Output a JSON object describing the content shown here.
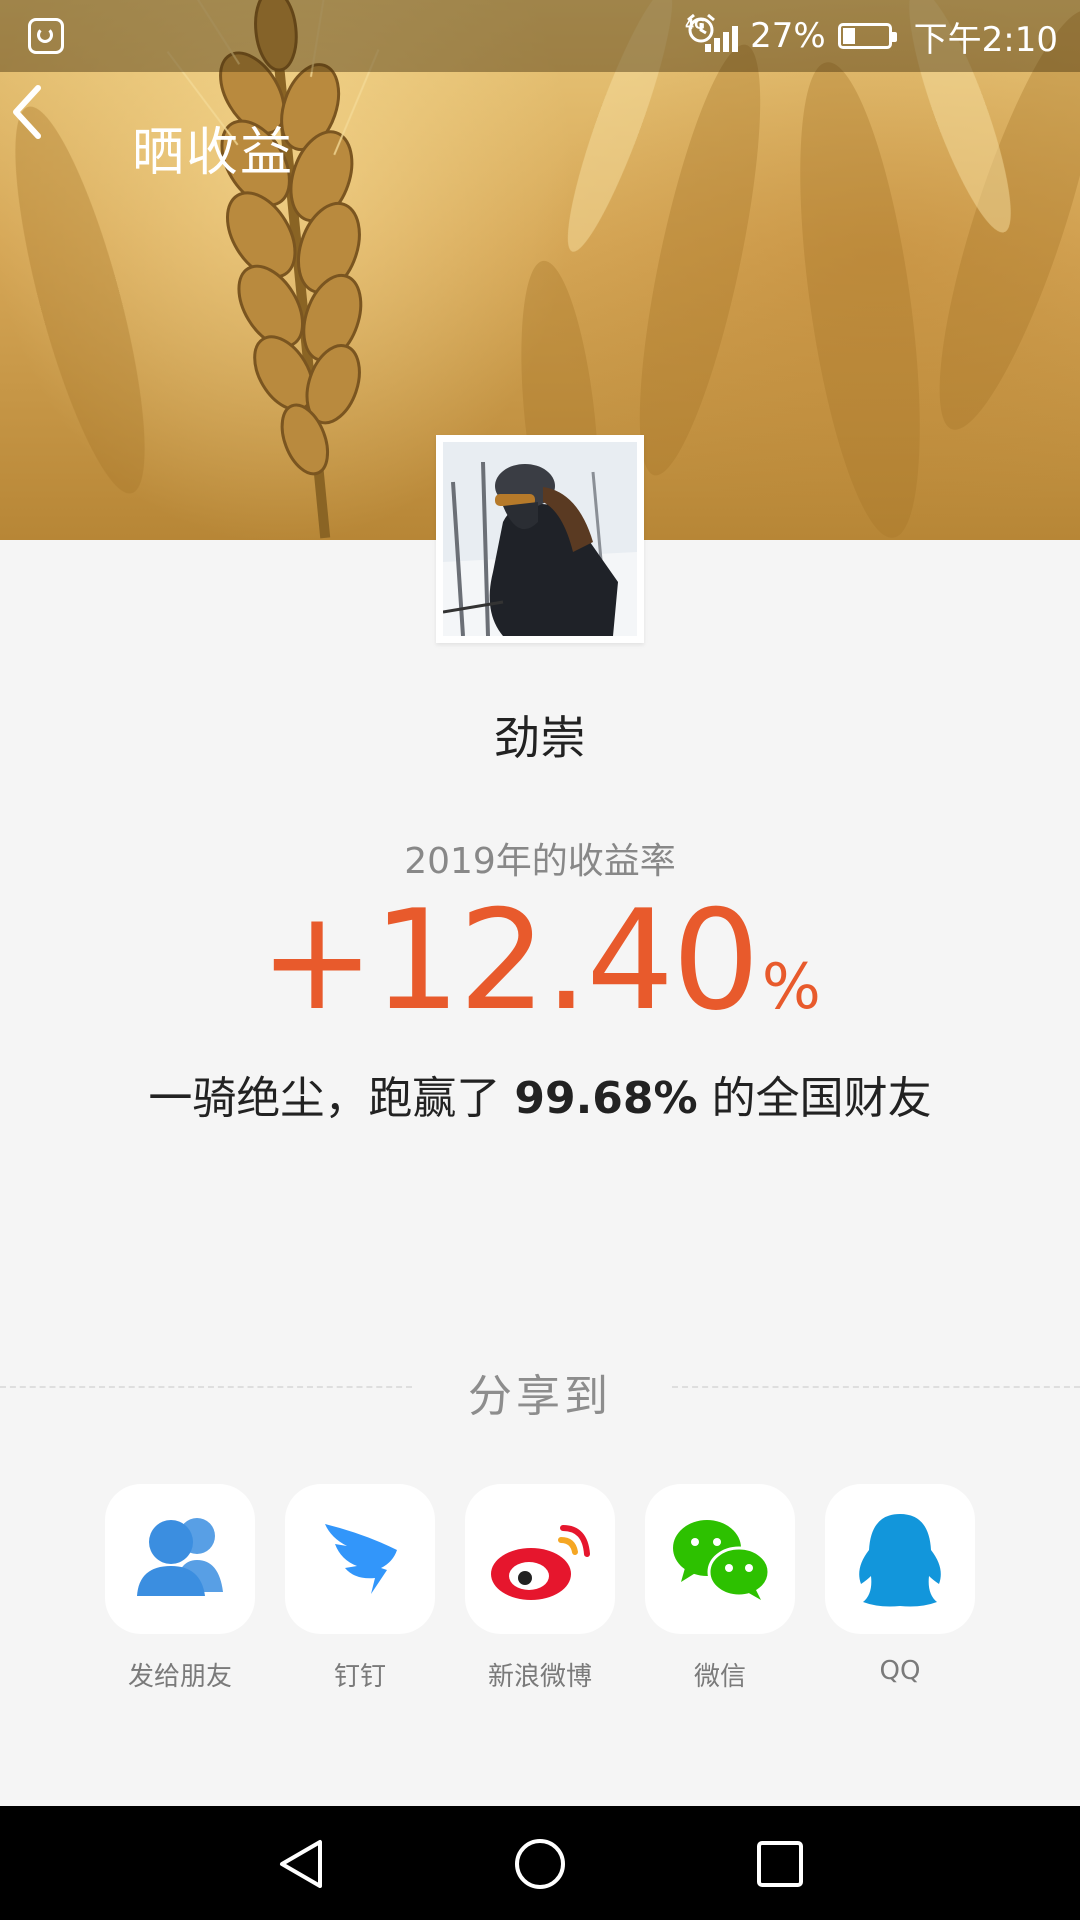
{
  "status_bar": {
    "network_label": "4G",
    "battery_percent": "27%",
    "time": "下午2:10"
  },
  "header": {
    "title": "晒收益"
  },
  "profile": {
    "name": "劲崇"
  },
  "yield": {
    "caption": "2019年的收益率",
    "value": "+12.40",
    "unit": "%"
  },
  "rank": {
    "prefix": "一骑绝尘，跑赢了 ",
    "percent": "99.68%",
    "suffix": " 的全国财友"
  },
  "share": {
    "title": "分享到",
    "targets": [
      {
        "label": "发给朋友",
        "icon": "friends-icon",
        "color": "#3b8ee0"
      },
      {
        "label": "钉钉",
        "icon": "dingtalk-icon",
        "color": "#3296fa"
      },
      {
        "label": "新浪微博",
        "icon": "weibo-icon",
        "color": "#e6162d"
      },
      {
        "label": "微信",
        "icon": "wechat-icon",
        "color": "#2dc100"
      },
      {
        "label": "QQ",
        "icon": "qq-icon",
        "color": "#1296db"
      }
    ]
  },
  "colors": {
    "accent": "#e85a2c",
    "background": "#f5f5f5"
  }
}
